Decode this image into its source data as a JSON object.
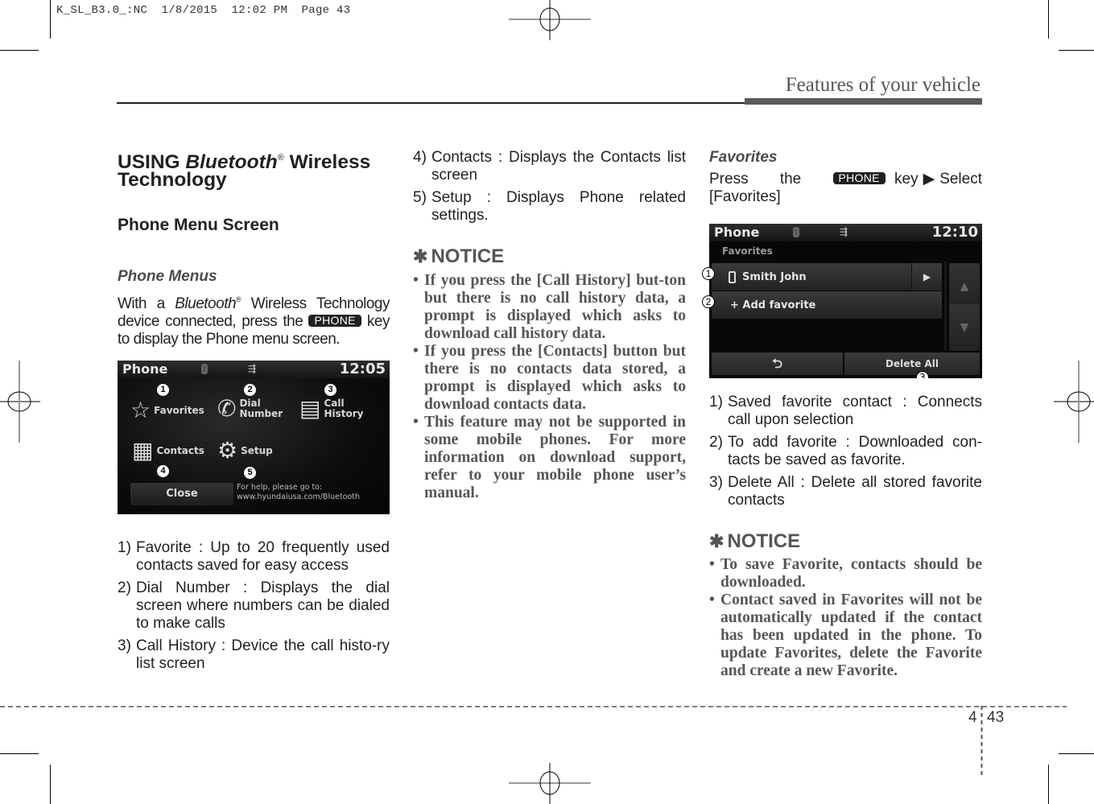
{
  "slug": "K_SL_B3.0_:NC  1/8/2015  12:02 PM  Page 43",
  "running_head": "Features of your vehicle",
  "page": {
    "chapter": "4",
    "number": "43"
  },
  "col1": {
    "title_prefix": "USING ",
    "title_italic": "Bluetooth",
    "title_reg": "®",
    "title_suffix": " Wireless Technology",
    "section": "Phone Menu Screen",
    "subsection": "Phone Menus",
    "intro_pre": "With a ",
    "intro_italic": "Bluetooth",
    "intro_reg": "®",
    "intro_mid": " Wireless Technology device connected, press the ",
    "key_label": "PHONE",
    "intro_post": " key to display the Phone menu screen.",
    "screen": {
      "title": "Phone",
      "time": "12:05",
      "usb_icon": "⇶",
      "items": [
        {
          "num": "1",
          "label": "Favorites",
          "icon": "star-icon",
          "glyph": "☆"
        },
        {
          "num": "2",
          "label": "Dial\nNumber",
          "icon": "handset-icon",
          "glyph": "✆"
        },
        {
          "num": "3",
          "label": "Call\nHistory",
          "icon": "call-history-icon",
          "glyph": "▤"
        },
        {
          "num": "4",
          "label": "Contacts",
          "icon": "contacts-icon",
          "glyph": "▦"
        },
        {
          "num": "5",
          "label": "Setup",
          "icon": "gear-icon",
          "glyph": "⚙"
        }
      ],
      "close_label": "Close",
      "help_line1": "For help, please go to:",
      "help_line2": "www.hyundaiusa.com/Bluetooth"
    },
    "list": [
      {
        "num": "1)",
        "text": "Favorite : Up to 20 frequently used contacts saved for easy access"
      },
      {
        "num": "2)",
        "text": "Dial Number : Displays the dial screen where numbers can be dialed to make calls"
      },
      {
        "num": "3)",
        "text": "Call History : Device the call histo-ry list screen"
      }
    ]
  },
  "col2": {
    "list": [
      {
        "num": "4)",
        "text": "Contacts : Displays the Contacts list screen"
      },
      {
        "num": "5)",
        "text": "Setup : Displays Phone related settings."
      }
    ],
    "notice_symbol": "✱",
    "notice_title": "NOTICE",
    "notice": [
      "If you press the [Call History] but-ton but there is no call history data, a prompt is displayed which asks to download call history data.",
      "If you press the [Contacts] button but there is no contacts data stored, a prompt is displayed which asks to download contacts data.",
      "This feature may not be supported in some mobile phones. For more information on download support, refer to your mobile phone user’s manual."
    ]
  },
  "col3": {
    "subsection": "Favorites",
    "intro_pre": "Press the ",
    "key_label": "PHONE",
    "intro_post": " key▶Select [Favorites]",
    "screen": {
      "title": "Phone",
      "time": "12:10",
      "usb_icon": "⇶",
      "subtitle": "Favorites",
      "contact": "Smith John",
      "add": "+ Add favorite",
      "delete_all": "Delete All",
      "back_glyph": "⮌",
      "go_glyph": "▶",
      "up_glyph": "▲",
      "down_glyph": "▼",
      "callouts": [
        "1",
        "2",
        "3"
      ]
    },
    "list": [
      {
        "num": "1)",
        "text": "Saved favorite contact : Connects call upon selection"
      },
      {
        "num": "2)",
        "text": "To add favorite : Downloaded con-tacts be saved as favorite."
      },
      {
        "num": "3)",
        "text": "Delete All : Delete all stored favorite contacts"
      }
    ],
    "notice_symbol": "✱",
    "notice_title": "NOTICE",
    "notice": [
      "To save Favorite, contacts should be downloaded.",
      "Contact saved in Favorites will not be automatically updated if the contact has been updated in the phone. To update Favorites, delete the Favorite and create a new Favorite."
    ]
  }
}
